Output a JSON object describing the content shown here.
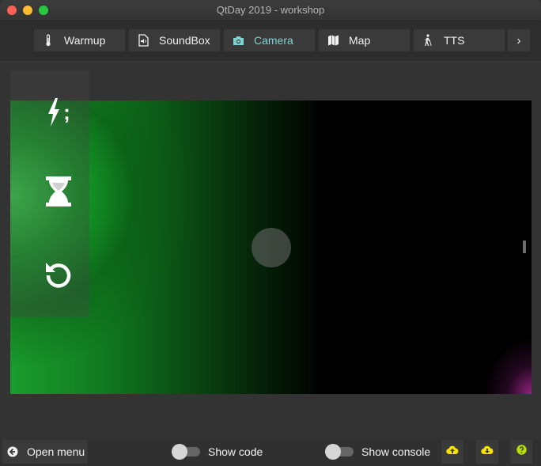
{
  "window": {
    "title": "QtDay 2019 - workshop"
  },
  "toolbar": {
    "tabs": [
      {
        "label": "Warmup",
        "icon": "thermometer-icon",
        "active": false
      },
      {
        "label": "SoundBox",
        "icon": "audio-file-icon",
        "active": false
      },
      {
        "label": "Camera",
        "icon": "camera-icon",
        "active": true
      },
      {
        "label": "Map",
        "icon": "map-icon",
        "active": false
      },
      {
        "label": "TTS",
        "icon": "walking-person-icon",
        "active": false
      }
    ],
    "more_label": "›"
  },
  "camera_controls": {
    "flash_label": ";",
    "icons": [
      "flash-icon",
      "hourglass-icon",
      "rotate-icon"
    ]
  },
  "bottom": {
    "open_menu_label": "Open menu",
    "show_code_label": "Show code",
    "show_code_on": false,
    "show_console_label": "Show console",
    "show_console_on": false
  },
  "colors": {
    "accent": "#7fd3d3",
    "upload_icon": "#f4e300",
    "help_icon": "#b7e000"
  }
}
